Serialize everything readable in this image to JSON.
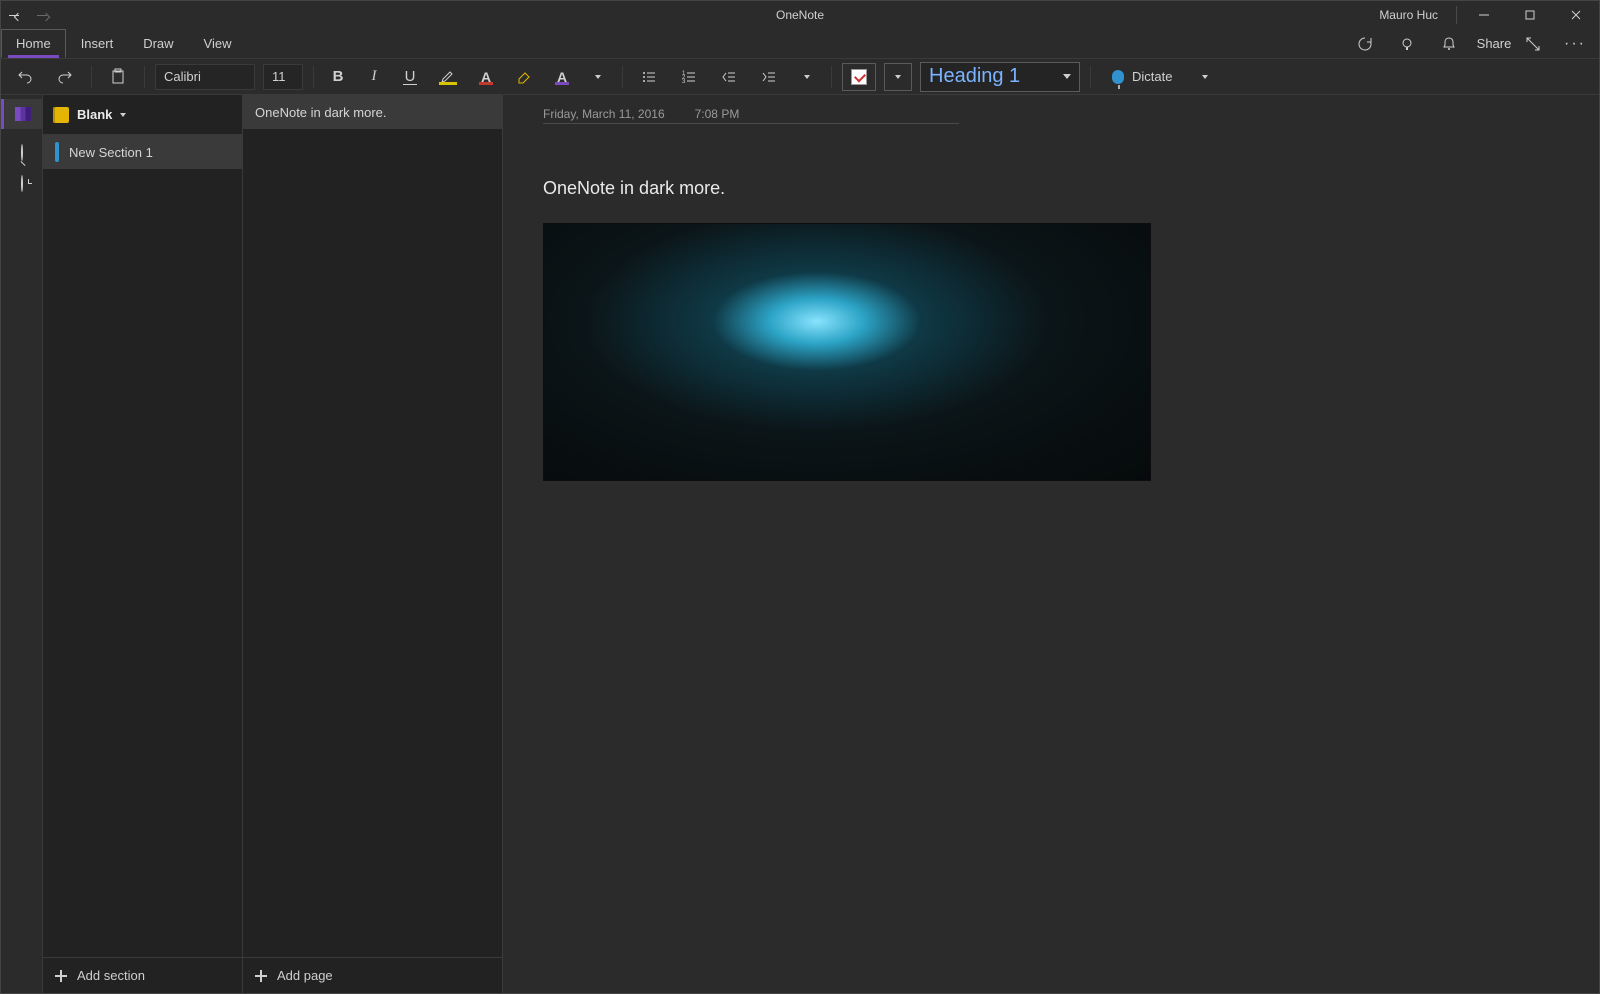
{
  "app": {
    "title": "OneNote",
    "user": "Mauro Huc"
  },
  "tabs": {
    "home": "Home",
    "insert": "Insert",
    "draw": "Draw",
    "view": "View",
    "active": "home"
  },
  "ribbon": {
    "font_name": "Calibri",
    "font_size": "11",
    "style_selected": "Heading 1",
    "dictate_label": "Dictate"
  },
  "header_actions": {
    "share_label": "Share"
  },
  "notebook": {
    "name": "Blank"
  },
  "sections": [
    {
      "name": "New Section 1",
      "selected": true
    }
  ],
  "pages": [
    {
      "title": "OneNote in dark more.",
      "selected": true
    }
  ],
  "add": {
    "section": "Add section",
    "page": "Add page"
  },
  "canvas": {
    "date": "Friday, March 11, 2016",
    "time": "7:08 PM",
    "title": "OneNote in dark more."
  }
}
